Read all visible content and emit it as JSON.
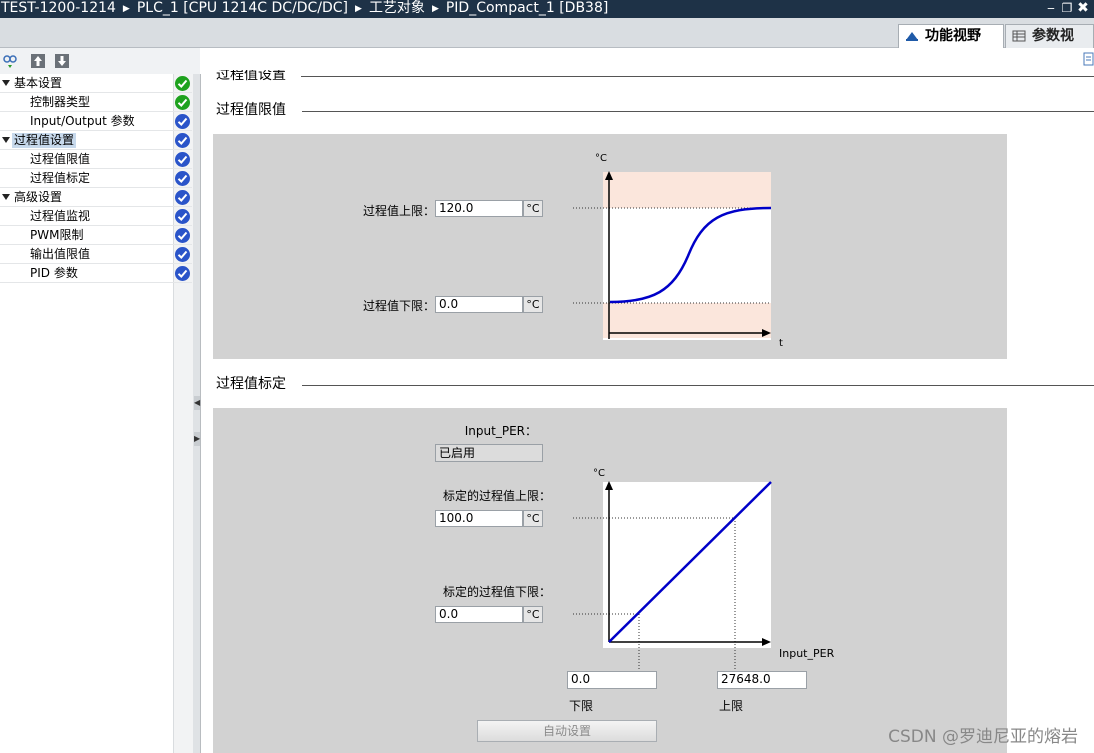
{
  "titlebar": {
    "crumbs": [
      "TEST-1200-1214",
      "PLC_1 [CPU 1214C DC/DC/DC]",
      "工艺对象",
      "PID_Compact_1 [DB38]"
    ],
    "window_controls": [
      "minimize-icon",
      "restore-icon",
      "close-icon"
    ]
  },
  "view_tabs": {
    "functional_view": "功能视野",
    "parameter_view": "参数视图"
  },
  "tree": {
    "items": [
      {
        "label": "基本设置",
        "level": 0,
        "expanded": true,
        "status": "ok"
      },
      {
        "label": "控制器类型",
        "level": 1,
        "status": "ok"
      },
      {
        "label": "Input/Output 参数",
        "level": 1,
        "status": "check"
      },
      {
        "label": "过程值设置",
        "level": 0,
        "expanded": true,
        "status": "check",
        "selected": true
      },
      {
        "label": "过程值限值",
        "level": 1,
        "status": "check"
      },
      {
        "label": "过程值标定",
        "level": 1,
        "status": "check"
      },
      {
        "label": "高级设置",
        "level": 0,
        "expanded": true,
        "status": "check"
      },
      {
        "label": "过程值监视",
        "level": 1,
        "status": "check"
      },
      {
        "label": "PWM限制",
        "level": 1,
        "status": "check"
      },
      {
        "label": "输出值限值",
        "level": 1,
        "status": "check"
      },
      {
        "label": "PID 参数",
        "level": 1,
        "status": "check"
      }
    ]
  },
  "colors": {
    "status_ok": "#1ea21e",
    "status_check": "#2a54c9",
    "curve": "#0000c8",
    "limit_band": "#fbe6dc",
    "panel": "#d2d2d2",
    "titlebar": "#1e3247"
  },
  "main": {
    "top_section_title": "过程值设置",
    "limits": {
      "section_title": "过程值限值",
      "upper_label": "过程值上限：",
      "upper_value": "120.0",
      "lower_label": "过程值下限：",
      "lower_value": "0.0",
      "unit": "°C",
      "chart_y_axis": "°C",
      "chart_x_axis": "t"
    },
    "scaling": {
      "section_title": "过程值标定",
      "input_label": "Input_PER：",
      "input_value": "已启用",
      "scaled_upper_label": "标定的过程值上限：",
      "scaled_upper_value": "100.0",
      "scaled_lower_label": "标定的过程值下限：",
      "scaled_lower_value": "0.0",
      "unit": "°C",
      "chart_y_axis": "°C",
      "chart_x_axis": "Input_PER",
      "low_value": "0.0",
      "low_label": "下限",
      "high_value": "27648.0",
      "high_label": "上限",
      "auto_button": "自动设置"
    }
  },
  "watermark": "CSDN @罗迪尼亚的熔岩"
}
